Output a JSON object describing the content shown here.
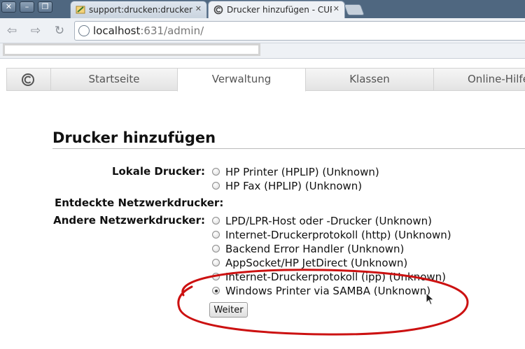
{
  "browser": {
    "tabs": [
      {
        "label": "support:drucken:drucken_",
        "active": false
      },
      {
        "label": "Drucker hinzufügen - CUP",
        "active": true
      }
    ],
    "url_host": "localhost",
    "url_rest": ":631/admin/"
  },
  "cups": {
    "nav": [
      "Startseite",
      "Verwaltung",
      "Klassen",
      "Online-Hilfe"
    ],
    "selected_nav": "Verwaltung",
    "title": "Drucker hinzufügen",
    "groups": {
      "local": "Lokale Drucker:",
      "discovered": "Entdeckte Netzwerkdrucker:",
      "other": "Andere Netzwerkdrucker:"
    },
    "local_printers": [
      "HP Printer (HPLIP) (Unknown)",
      "HP Fax (HPLIP) (Unknown)"
    ],
    "other_printers": [
      "LPD/LPR-Host oder -Drucker (Unknown)",
      "Internet-Druckerprotokoll (http) (Unknown)",
      "Backend Error Handler (Unknown)",
      "AppSocket/HP JetDirect (Unknown)",
      "Internet-Druckerprotokoll (ipp) (Unknown)",
      "Windows Printer via SAMBA (Unknown)"
    ],
    "selected_printer": "Windows Printer via SAMBA (Unknown)",
    "submit_label": "Weiter"
  },
  "colors": {
    "annotation": "#cc1111",
    "chrome_dark": "#4f6780"
  }
}
